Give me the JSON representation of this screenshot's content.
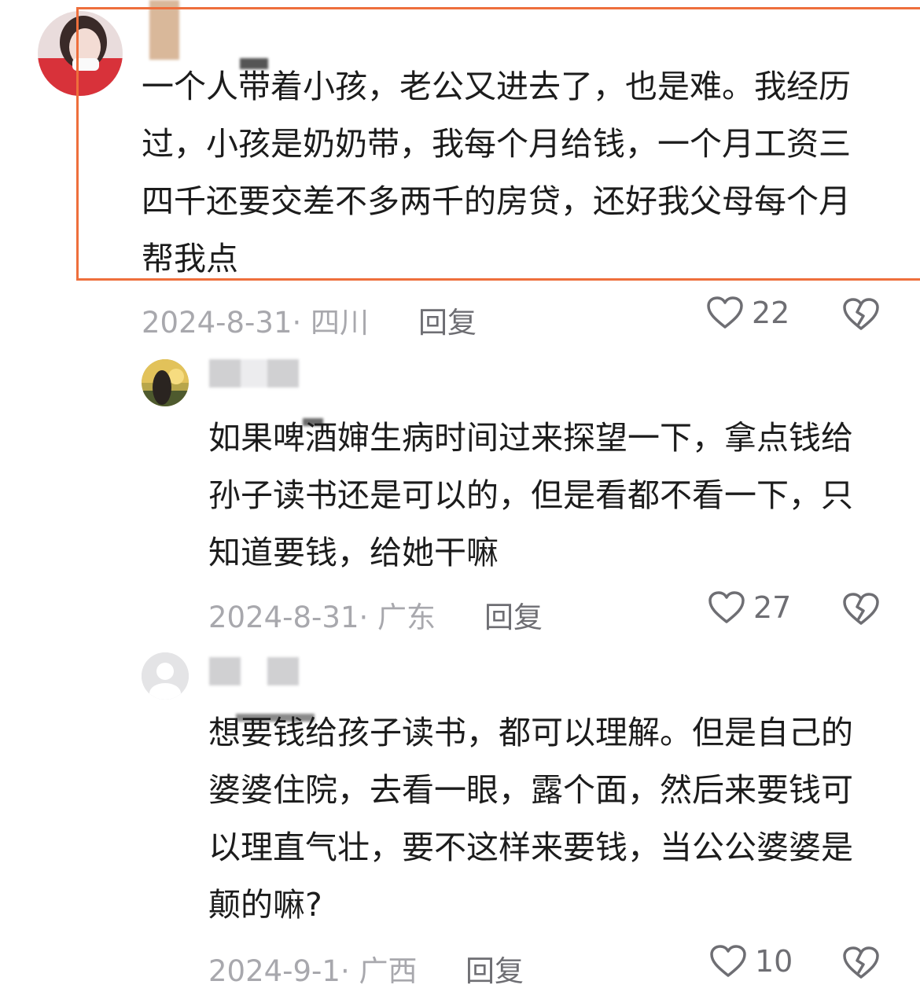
{
  "main_comment": {
    "text": "一个人带着小孩，老公又进去了，也是难。我经历过，小孩是奶奶带，我每个月给钱，一个月工资三四千还要交差不多两千的房贷，还好我父母每个月帮我点",
    "date": "2024-8-31· 四川",
    "reply_label": "回复",
    "likes": "22"
  },
  "replies": [
    {
      "text": "如果啤酒婶生病时间过来探望一下，拿点钱给孙子读书还是可以的，但是看都不看一下，只知道要钱，给她干嘛",
      "date": "2024-8-31· 广东",
      "reply_label": "回复",
      "likes": "27"
    },
    {
      "text": "想要钱给孩子读书，都可以理解。但是自己的婆婆住院，去看一眼，露个面，然后来要钱可以理直气壮，要不这样来要钱，当公公婆婆是颠的嘛?",
      "date": "2024-9-1· 广西",
      "reply_label": "回复",
      "likes": "10"
    }
  ],
  "colors": {
    "highlight_border": "#ee6f3c",
    "meta_text": "#a8a8ad",
    "icon": "#6e6e73"
  },
  "icons": [
    "heart-outline-icon",
    "broken-heart-icon"
  ]
}
